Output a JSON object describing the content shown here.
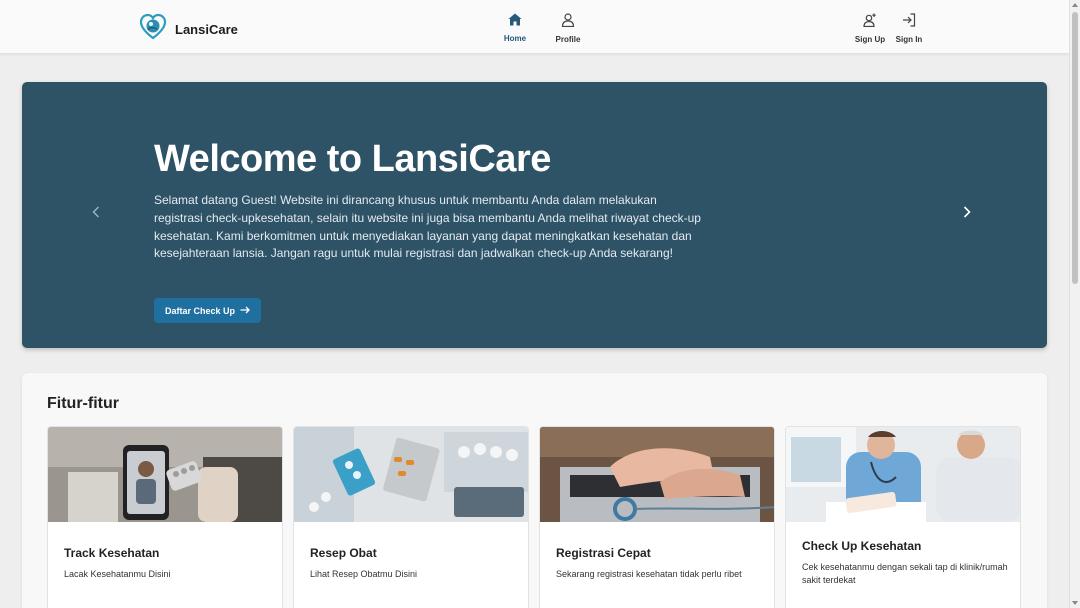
{
  "navbar": {
    "brand_name": "LansiCare",
    "home_label": "Home",
    "profile_label": "Profile",
    "signup_label": "Sign Up",
    "signin_label": "Sign In",
    "active_color": "#255a7a"
  },
  "hero": {
    "title": "Welcome to LansiCare",
    "text": "Selamat datang Guest! Website ini dirancang khusus untuk membantu Anda dalam melakukan registrasi check-upkesehatan, selain itu website ini juga bisa membantu Anda melihat riwayat check-up kesehatan. Kami berkomitmen untuk menyediakan layanan yang dapat meningkatkan kesehatan dan kesejahteraan lansia. Jangan ragu untuk mulai registrasi dan jadwalkan check-up Anda sekarang!",
    "button_label": "Daftar Check Up",
    "background_color": "#2e5266",
    "button_color": "#1f6fa0"
  },
  "features": {
    "title": "Fitur-fitur",
    "cards": [
      {
        "title": "Track Kesehatan",
        "desc": "Lacak Kesehatanmu Disini"
      },
      {
        "title": "Resep Obat",
        "desc": "Lihat Resep Obatmu Disini"
      },
      {
        "title": "Registrasi Cepat",
        "desc": "Sekarang registrasi kesehatan tidak perlu ribet"
      },
      {
        "title": "Check Up Kesehatan",
        "desc": "Cek kesehatanmu dengan sekali tap di klinik/rumah sakit terdekat"
      }
    ]
  },
  "icons": [
    "logo-icon",
    "home-icon",
    "user-icon",
    "user-plus-icon",
    "sign-in-icon",
    "chevron-left-icon",
    "chevron-right-icon",
    "arrow-right-icon"
  ]
}
